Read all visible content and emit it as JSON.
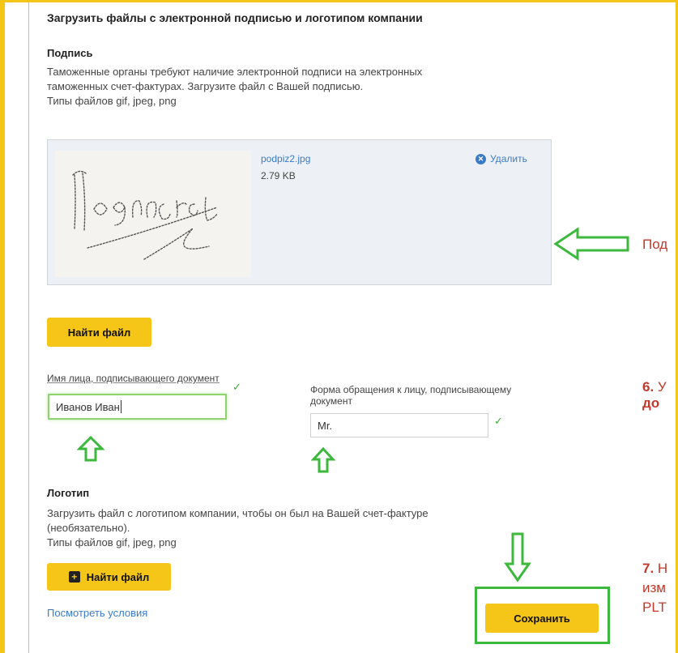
{
  "section_title": "Загрузить файлы с электронной подписью и логотипом компании",
  "signature": {
    "heading": "Подпись",
    "desc_line1": "Таможенные органы требуют наличие электронной подписи на электронных",
    "desc_line2": "таможенных счет-фактурах. Загрузите файл с Вашей подписью.",
    "types": "Типы файлов gif, jpeg, png",
    "file_name": "podpiz2.jpg",
    "file_size": "2.79 KB",
    "delete_label": "Удалить",
    "find_button": "Найти файл"
  },
  "signer": {
    "name_label": "Имя лица, подписывающего документ",
    "name_value": "Иванов Иван",
    "form_label_line1": "Форма обращения к лицу, подписывающему",
    "form_label_line2": "документ",
    "form_value": "Mr."
  },
  "logo": {
    "heading": "Логотип",
    "desc_line1": "Загрузить файл с логотипом компании, чтобы он был на Вашей счет-фактуре",
    "desc_line2": "(необязательно).",
    "types": "Типы файлов gif, jpeg, png",
    "find_button": "Найти файл"
  },
  "terms_link": "Посмотреть условия",
  "save_button": "Сохранить",
  "annotations": {
    "signature_note": "Под",
    "step6_number": "6.",
    "step6_text": "У",
    "step6_line2": "до",
    "step7_number": "7.",
    "step7_text": "Н",
    "step7_line2": "изм",
    "step7_line3": "PLT"
  },
  "colors": {
    "accent_yellow": "#f5c518",
    "link_blue": "#3a7bc8",
    "annotation_green": "#3cb83c",
    "annotation_red": "#c0392b"
  }
}
